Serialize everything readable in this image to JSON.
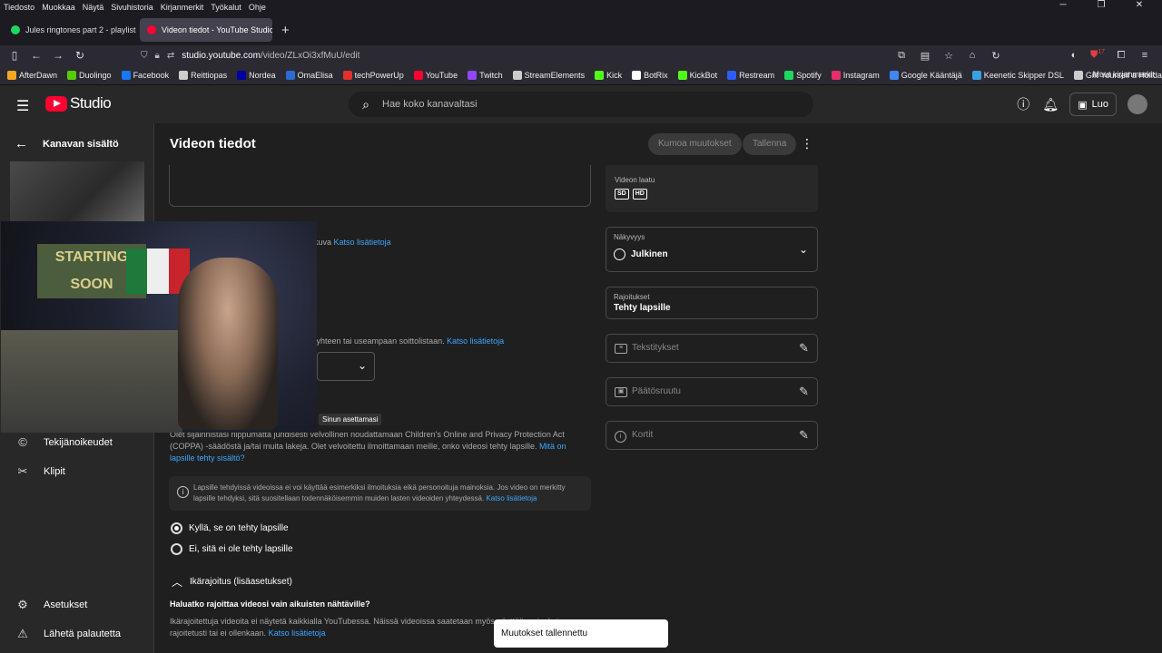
{
  "browser": {
    "menu": [
      "Tiedosto",
      "Muokkaa",
      "Näytä",
      "Sivuhistoria",
      "Kirjanmerkit",
      "Työkalut",
      "Ohje"
    ],
    "tabs": [
      {
        "label": "Jules ringtones part 2 - playlist",
        "color": "#1ed760"
      },
      {
        "label": "Videon tiedot - YouTube Studio",
        "color": "#ff0033"
      }
    ],
    "url_host": "studio.youtube.com",
    "url_path": "/video/ZLxOi3xfMuU/edit",
    "badge_count": "17",
    "bookmarks": [
      {
        "label": "AfterDawn",
        "color": "#f5a623"
      },
      {
        "label": "Duolingo",
        "color": "#58cc02"
      },
      {
        "label": "Facebook",
        "color": "#1877f2"
      },
      {
        "label": "Reittiopas",
        "color": "#cccccc"
      },
      {
        "label": "Nordea",
        "color": "#0000a0"
      },
      {
        "label": "OmaElisa",
        "color": "#2a6cd4"
      },
      {
        "label": "techPowerUp",
        "color": "#e03030"
      },
      {
        "label": "YouTube",
        "color": "#ff0033"
      },
      {
        "label": "Twitch",
        "color": "#9146ff"
      },
      {
        "label": "StreamElements",
        "color": "#cccccc"
      },
      {
        "label": "Kick",
        "color": "#53fc18"
      },
      {
        "label": "BotRix",
        "color": "#ffffff"
      },
      {
        "label": "KickBot",
        "color": "#53fc18"
      },
      {
        "label": "Restream",
        "color": "#2d5cf6"
      },
      {
        "label": "Spotify",
        "color": "#1ed760"
      },
      {
        "label": "Instagram",
        "color": "#e1306c"
      },
      {
        "label": "Google Kääntäjä",
        "color": "#4285f4"
      },
      {
        "label": "Keenetic Skipper DSL",
        "color": "#3aa0e0"
      },
      {
        "label": "Gift Yourself a Holiday...",
        "color": "#cccccc"
      }
    ],
    "other_bookmarks": "Muut kirjanmerkit"
  },
  "header": {
    "logo_text": "Studio",
    "search_placeholder": "Hae koko kanavaltasi",
    "create_label": "Luo"
  },
  "sidebar": {
    "back_label": "Kanavan sisältö",
    "items": [
      {
        "label": "Tekijänoikeudet"
      },
      {
        "label": "Klipit"
      },
      {
        "label": "Asetukset"
      },
      {
        "label": "Lähetä palautetta"
      }
    ]
  },
  "webcam": {
    "poster_text": "STARTING SOON"
  },
  "main": {
    "title": "Videon tiedot",
    "undo_label": "Kumoa muutokset",
    "save_label": "Tallenna",
    "frag1_text": "ukuva",
    "frag_link": "Katso lisätietoja",
    "frag2_text": "o yhteen tai useampaan soittolistaan.",
    "tooltip": "Sinun asettamasi",
    "coppa_text": "Olet sijainnistasi riippumatta juridisesti velvollinen noudattamaan Children's Online and Privacy Protection Act (COPPA) -säädöstä ja/tai muita lakeja. Olet velvoitettu ilmoittamaan meille, onko videosi tehty lapsille.",
    "coppa_link": "Mitä on lapsille tehty sisältö?",
    "info_text": "Lapsille tehdyissä videoissa ei voi käyttää esimerkiksi ilmoituksia eikä personoituja mainoksia. Jos video on merkitty lapsille tehdyksi, sitä suositellaan todennäköisemmin muiden lasten videoiden yhteydessä.",
    "info_link": "Katso lisätietoja",
    "radio_yes": "Kyllä, se on tehty lapsille",
    "radio_no": "Ei, sitä ei ole tehty lapsille",
    "age_title": "Ikärajoitus (lisäasetukset)",
    "age_question": "Haluatko rajoittaa videosi vain aikuisten nähtäville?",
    "age_text": "Ikärajoitettuja videoita ei näytetä kaikkialla YouTubessa. Näissä videoissa saatetaan myös näyttää mainoksia rajoitetusti tai ei ollenkaan.",
    "age_link": "Katso lisätietoja"
  },
  "right": {
    "quality_label": "Videon laatu",
    "quality_badges": [
      "SD",
      "HD"
    ],
    "visibility_label": "Näkyvyys",
    "visibility_value": "Julkinen",
    "restrictions_label": "Rajoitukset",
    "restrictions_value": "Tehty lapsille",
    "subtitles": "Tekstitykset",
    "end_screen": "Päätösruutu",
    "cards": "Kortit"
  },
  "toast": "Muutokset tallennettu"
}
